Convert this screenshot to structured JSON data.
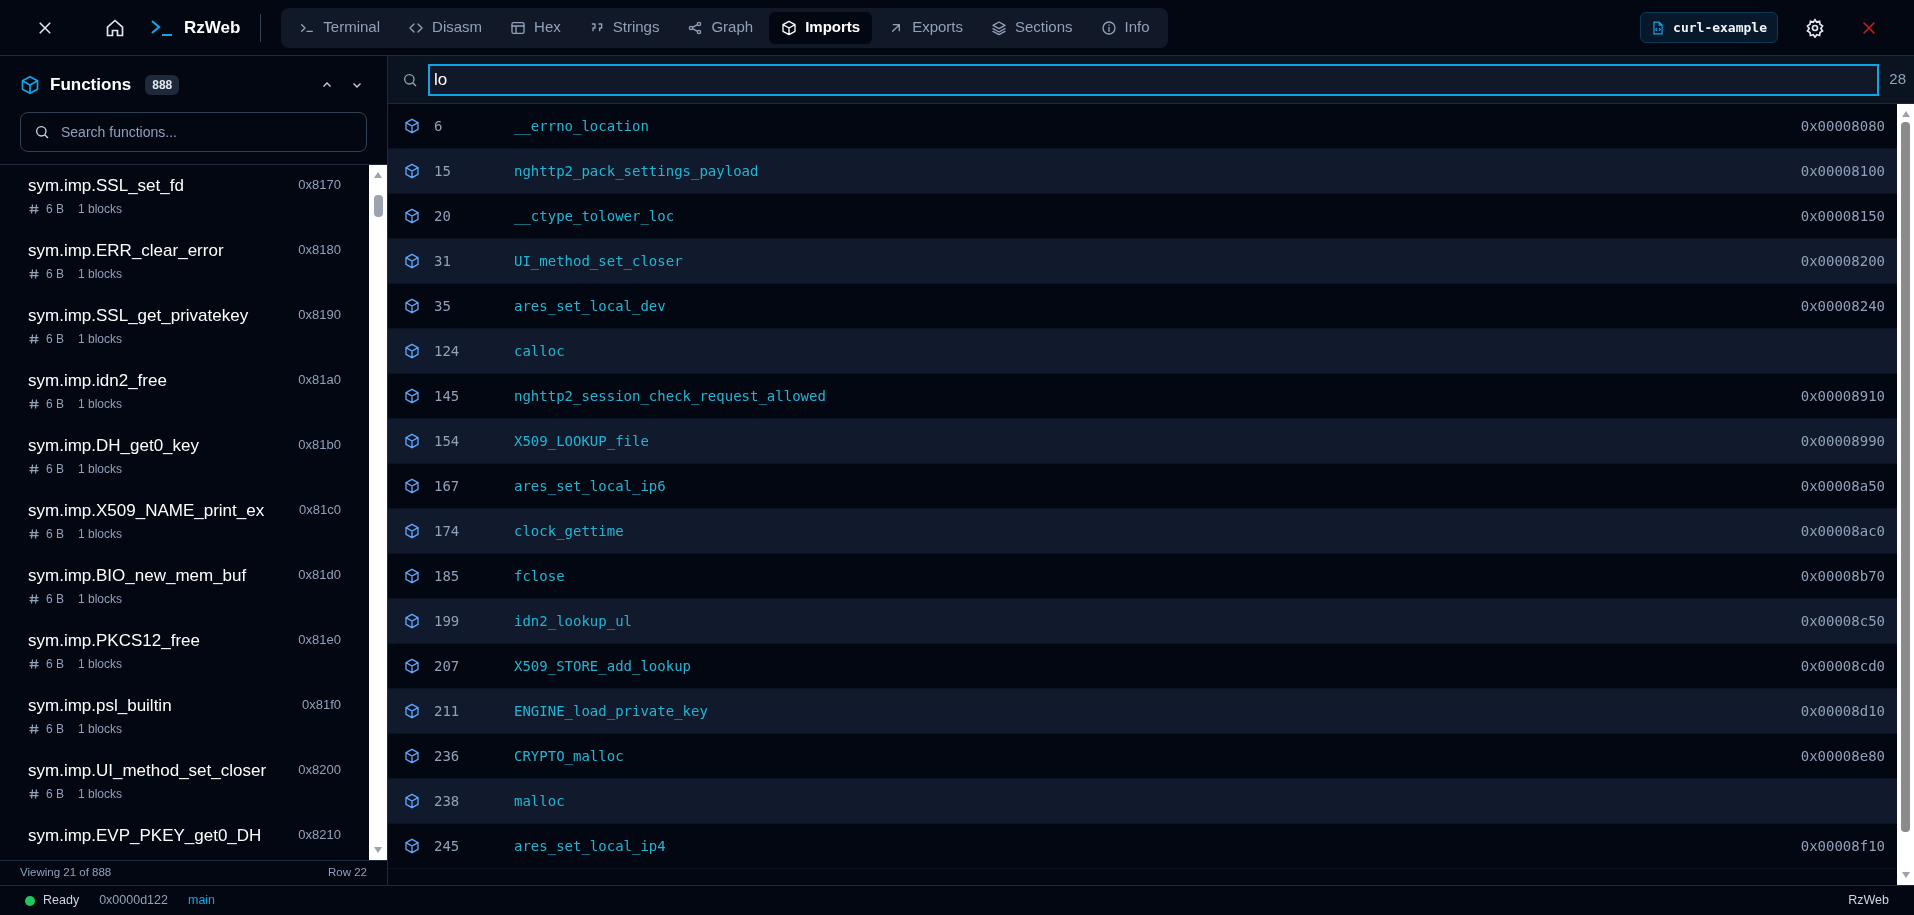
{
  "window": {
    "title": "RzWeb"
  },
  "tabs": [
    {
      "label": "Terminal",
      "selected": false
    },
    {
      "label": "Disasm",
      "selected": false
    },
    {
      "label": "Hex",
      "selected": false
    },
    {
      "label": "Strings",
      "selected": false
    },
    {
      "label": "Graph",
      "selected": false
    },
    {
      "label": "Imports",
      "selected": true
    },
    {
      "label": "Exports",
      "selected": false
    },
    {
      "label": "Sections",
      "selected": false
    },
    {
      "label": "Info",
      "selected": false
    }
  ],
  "file": "curl-example",
  "sidebar": {
    "title": "Functions",
    "count": "888",
    "search_placeholder": "Search functions...",
    "items": [
      {
        "name": "sym.imp.SSL_set_fd",
        "address": "0x8170",
        "size": "6 B",
        "blocks": "1 blocks"
      },
      {
        "name": "sym.imp.ERR_clear_error",
        "address": "0x8180",
        "size": "6 B",
        "blocks": "1 blocks"
      },
      {
        "name": "sym.imp.SSL_get_privatekey",
        "address": "0x8190",
        "size": "6 B",
        "blocks": "1 blocks"
      },
      {
        "name": "sym.imp.idn2_free",
        "address": "0x81a0",
        "size": "6 B",
        "blocks": "1 blocks"
      },
      {
        "name": "sym.imp.DH_get0_key",
        "address": "0x81b0",
        "size": "6 B",
        "blocks": "1 blocks"
      },
      {
        "name": "sym.imp.X509_NAME_print_ex",
        "address": "0x81c0",
        "size": "6 B",
        "blocks": "1 blocks"
      },
      {
        "name": "sym.imp.BIO_new_mem_buf",
        "address": "0x81d0",
        "size": "6 B",
        "blocks": "1 blocks"
      },
      {
        "name": "sym.imp.PKCS12_free",
        "address": "0x81e0",
        "size": "6 B",
        "blocks": "1 blocks"
      },
      {
        "name": "sym.imp.psl_builtin",
        "address": "0x81f0",
        "size": "6 B",
        "blocks": "1 blocks"
      },
      {
        "name": "sym.imp.UI_method_set_closer",
        "address": "0x8200",
        "size": "6 B",
        "blocks": "1 blocks"
      },
      {
        "name": "sym.imp.EVP_PKEY_get0_DH",
        "address": "0x8210"
      }
    ],
    "footer": {
      "viewing": "Viewing 21 of 888",
      "row": "Row 22"
    }
  },
  "imports": {
    "filter_value": "lo",
    "match_count": "28",
    "rows": [
      {
        "ordinal": "6",
        "name": "__errno_location",
        "address": "0x00008080"
      },
      {
        "ordinal": "15",
        "name": "nghttp2_pack_settings_payload",
        "address": "0x00008100"
      },
      {
        "ordinal": "20",
        "name": "__ctype_tolower_loc",
        "address": "0x00008150"
      },
      {
        "ordinal": "31",
        "name": "UI_method_set_closer",
        "address": "0x00008200"
      },
      {
        "ordinal": "35",
        "name": "ares_set_local_dev",
        "address": "0x00008240"
      },
      {
        "ordinal": "124",
        "name": "calloc"
      },
      {
        "ordinal": "145",
        "name": "nghttp2_session_check_request_allowed",
        "address": "0x00008910"
      },
      {
        "ordinal": "154",
        "name": "X509_LOOKUP_file",
        "address": "0x00008990"
      },
      {
        "ordinal": "167",
        "name": "ares_set_local_ip6",
        "address": "0x00008a50"
      },
      {
        "ordinal": "174",
        "name": "clock_gettime",
        "address": "0x00008ac0"
      },
      {
        "ordinal": "185",
        "name": "fclose",
        "address": "0x00008b70"
      },
      {
        "ordinal": "199",
        "name": "idn2_lookup_ul",
        "address": "0x00008c50"
      },
      {
        "ordinal": "207",
        "name": "X509_STORE_add_lookup",
        "address": "0x00008cd0"
      },
      {
        "ordinal": "211",
        "name": "ENGINE_load_private_key",
        "address": "0x00008d10"
      },
      {
        "ordinal": "236",
        "name": "CRYPTO_malloc",
        "address": "0x00008e80"
      },
      {
        "ordinal": "238",
        "name": "malloc"
      },
      {
        "ordinal": "245",
        "name": "ares_set_local_ip4",
        "address": "0x00008f10"
      }
    ]
  },
  "status_bar": {
    "state": "Ready",
    "address": "0x0000d122",
    "branch": "main",
    "app": "RzWeb"
  }
}
